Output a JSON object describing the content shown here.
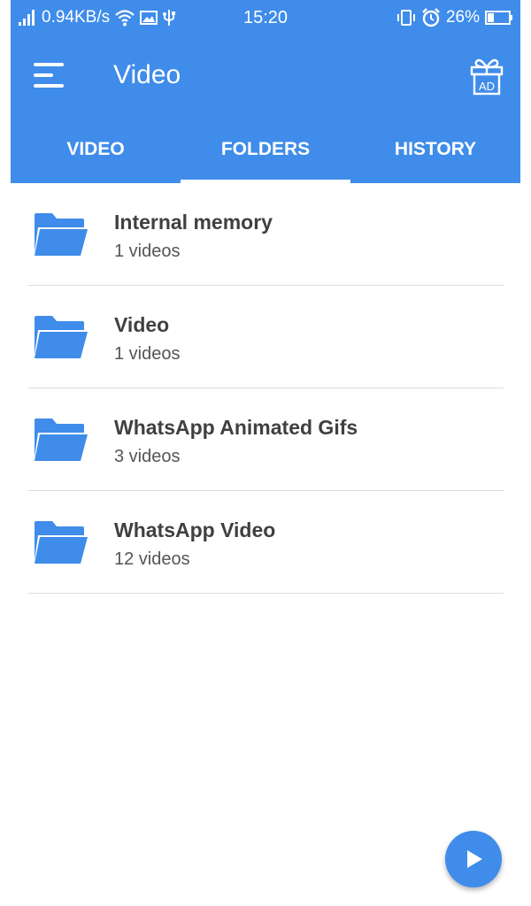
{
  "status_bar": {
    "net_speed": "0.94KB/s",
    "time": "15:20",
    "battery": "26%"
  },
  "app_bar": {
    "title": "Video",
    "menu_icon": "hamburger-menu-icon",
    "gift_icon": "gift-ad-icon",
    "gift_badge": "AD"
  },
  "tabs": [
    {
      "label": "VIDEO",
      "active": false
    },
    {
      "label": "FOLDERS",
      "active": true
    },
    {
      "label": "HISTORY",
      "active": false
    }
  ],
  "folders": [
    {
      "name": "Internal memory",
      "count": "1 videos"
    },
    {
      "name": "Video",
      "count": "1 videos"
    },
    {
      "name": "WhatsApp Animated Gifs",
      "count": "3 videos"
    },
    {
      "name": "WhatsApp Video",
      "count": "12 videos"
    }
  ],
  "fab": {
    "icon": "play-icon"
  },
  "colors": {
    "primary": "#3f8cea",
    "folder": "#3f8cea",
    "text_primary": "#404040",
    "text_secondary": "#555555",
    "divider": "#dcdcdc"
  }
}
